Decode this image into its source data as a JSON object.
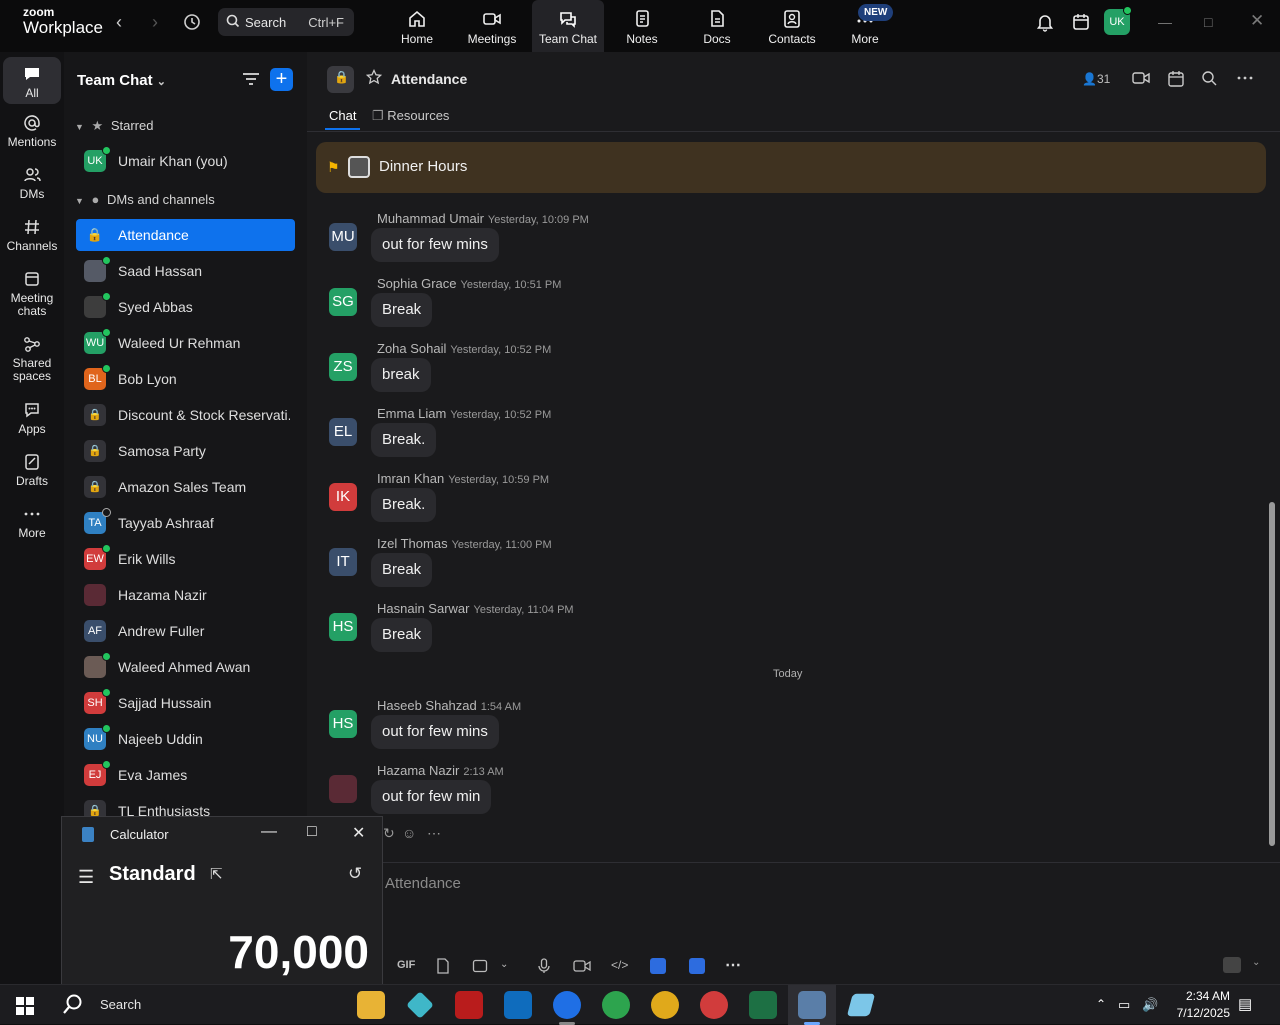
{
  "app": {
    "brand_small": "zoom",
    "brand_big": "Workplace"
  },
  "topbar": {
    "search_label": "Search",
    "search_shortcut": "Ctrl+F",
    "nav": [
      {
        "label": "Home",
        "icon": "home-icon"
      },
      {
        "label": "Meetings",
        "icon": "video-icon"
      },
      {
        "label": "Team Chat",
        "icon": "chat-icon"
      },
      {
        "label": "Notes",
        "icon": "notes-icon"
      },
      {
        "label": "Docs",
        "icon": "docs-icon"
      },
      {
        "label": "Contacts",
        "icon": "contacts-icon"
      },
      {
        "label": "More",
        "icon": "more-icon"
      }
    ],
    "new_badge": "NEW",
    "avatar": "UK"
  },
  "rail": [
    {
      "label": "All"
    },
    {
      "label": "Mentions"
    },
    {
      "label": "DMs"
    },
    {
      "label": "Channels"
    },
    {
      "label": "Meeting chats"
    },
    {
      "label": "Shared spaces"
    },
    {
      "label": "Apps"
    },
    {
      "label": "Drafts"
    },
    {
      "label": "More"
    }
  ],
  "sidebar": {
    "title": "Team Chat",
    "starred_label": "Starred",
    "dms_label": "DMs and channels",
    "starred_items": [
      {
        "initials": "UK",
        "name": "Umair Khan (you)",
        "color": "#24a065"
      }
    ],
    "items": [
      {
        "initials": "",
        "name": "Attendance",
        "color": "#0e72ed"
      },
      {
        "initials": "",
        "name": "Saad Hassan",
        "color": "#555a66"
      },
      {
        "initials": "",
        "name": "Syed Abbas",
        "color": "#3d3d3d"
      },
      {
        "initials": "WU",
        "name": "Waleed Ur Rehman",
        "color": "#24a065"
      },
      {
        "initials": "BL",
        "name": "Bob Lyon",
        "color": "#e0651c"
      },
      {
        "initials": "",
        "name": "Discount & Stock Reservati...",
        "color": "#333338"
      },
      {
        "initials": "",
        "name": "Samosa Party",
        "color": "#333338"
      },
      {
        "initials": "",
        "name": "Amazon Sales Team",
        "color": "#333338"
      },
      {
        "initials": "TA",
        "name": "Tayyab Ashraaf",
        "color": "#2f80c2"
      },
      {
        "initials": "EW",
        "name": "Erik Wills",
        "color": "#d13c3c"
      },
      {
        "initials": "",
        "name": "Hazama Nazir",
        "color": "#5a2a35"
      },
      {
        "initials": "AF",
        "name": "Andrew Fuller",
        "color": "#3a4e6b"
      },
      {
        "initials": "",
        "name": "Waleed Ahmed Awan",
        "color": "#6b5b55"
      },
      {
        "initials": "SH",
        "name": "Sajjad Hussain",
        "color": "#d13c3c"
      },
      {
        "initials": "NU",
        "name": "Najeeb Uddin",
        "color": "#2f80c2"
      },
      {
        "initials": "EJ",
        "name": "Eva James",
        "color": "#d13c3c"
      },
      {
        "initials": "",
        "name": "TL Enthusiasts",
        "color": "#333338"
      }
    ]
  },
  "channel": {
    "name": "Attendance",
    "members": "31",
    "tabs": [
      "Chat",
      "Resources"
    ],
    "pinned": "Dinner Hours",
    "day_separator": "Today",
    "composer_placeholder": "Attendance",
    "gif_label": "GIF"
  },
  "messages": [
    {
      "initials": "MU",
      "color": "#3a4e6b",
      "sender": "Muhammad Umair",
      "time": "Yesterday, 10:09 PM",
      "text": "out for few mins"
    },
    {
      "initials": "SG",
      "color": "#24a065",
      "sender": "Sophia Grace",
      "time": "Yesterday, 10:51 PM",
      "text": "Break"
    },
    {
      "initials": "ZS",
      "color": "#24a065",
      "sender": "Zoha Sohail",
      "time": "Yesterday, 10:52 PM",
      "text": "break"
    },
    {
      "initials": "EL",
      "color": "#3a4e6b",
      "sender": "Emma Liam",
      "time": "Yesterday, 10:52 PM",
      "text": "Break."
    },
    {
      "initials": "IK",
      "color": "#d13c3c",
      "sender": "Imran Khan",
      "time": "Yesterday, 10:59 PM",
      "text": "Break."
    },
    {
      "initials": "IT",
      "color": "#3a4e6b",
      "sender": "Izel Thomas",
      "time": "Yesterday, 11:00 PM",
      "text": "Break"
    },
    {
      "initials": "HS",
      "color": "#24a065",
      "sender": "Hasnain Sarwar",
      "time": "Yesterday, 11:04 PM",
      "text": "Break"
    },
    {
      "initials": "HS",
      "color": "#24a065",
      "sender": "Haseeb Shahzad",
      "time": "1:54 AM",
      "text": "out for few mins"
    },
    {
      "initials": "",
      "color": "#5a2a35",
      "sender": "Hazama Nazir",
      "time": "2:13 AM",
      "text": "out for few min"
    }
  ],
  "calculator": {
    "title": "Calculator",
    "mode": "Standard",
    "display": "70,000"
  },
  "taskbar": {
    "search_label": "Search",
    "time": "2:34 AM",
    "date": "7/12/2025"
  }
}
